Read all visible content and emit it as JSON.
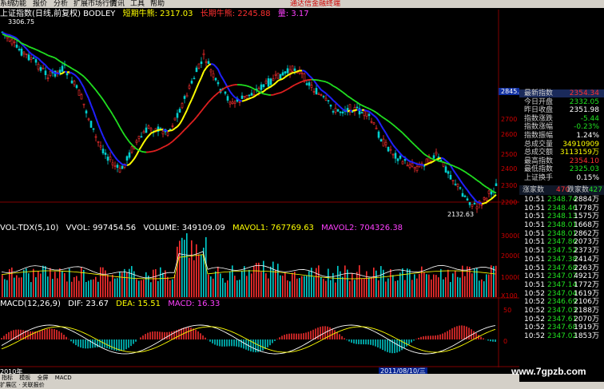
{
  "menu": [
    "系统",
    "功能",
    "报价",
    "分析",
    "扩展市场行情",
    "资讯",
    "工具",
    "帮助"
  ],
  "brand": "通达信金融终端",
  "main_legend": {
    "title": "上证指数(日线,前复权) BODLEY",
    "short_line": "短期牛熊: 2317.03",
    "long_line": "长期牛熊: 2245.88",
    "qty": "量: 3.17"
  },
  "price_axis": [
    "2845.5",
    "2700",
    "2600",
    "2500",
    "2400",
    "2300",
    "2200"
  ],
  "high_marker": "3306.75",
  "low_marker": "2132.63",
  "vol_legend": {
    "name": "VOL-TDX(5,10)",
    "vvol": "VVOL: 997454.56",
    "volume": "VOLUME: 349109.09",
    "mavol1": "MAVOL1: 767769.63",
    "mavol2": "MAVOL2: 704326.38"
  },
  "vol_axis": [
    "30000",
    "20000",
    "10000",
    "X100"
  ],
  "macd_legend": {
    "name": "MACD(12,26,9)",
    "dif": "DIF: 23.67",
    "dea": "DEA: 15.51",
    "macd": "MACD: 16.33"
  },
  "macd_axis": [
    "50",
    "0"
  ],
  "quote_panel": [
    {
      "k": "最新指数",
      "v": "2354.34",
      "c": "red"
    },
    {
      "k": "今日开盘",
      "v": "2332.05",
      "c": "green"
    },
    {
      "k": "昨日收盘",
      "v": "2351.98",
      "c": "white"
    },
    {
      "k": "指数涨跌",
      "v": "-5.44",
      "c": "green"
    },
    {
      "k": "指数涨幅",
      "v": "-0.23%",
      "c": "green"
    },
    {
      "k": "指数振幅",
      "v": "1.24%",
      "c": "white"
    },
    {
      "k": "总成交量",
      "v": "34910909",
      "c": "yellow"
    },
    {
      "k": "总成交额",
      "v": "3113159万",
      "c": "yellow"
    },
    {
      "k": "最高指数",
      "v": "2354.10",
      "c": "red"
    },
    {
      "k": "最低指数",
      "v": "2325.03",
      "c": "green"
    },
    {
      "k": "上证换手",
      "v": "0.15%",
      "c": "white"
    }
  ],
  "updown": {
    "up_label": "涨家数",
    "up": "470",
    "down_label": "跌家数",
    "down": "427"
  },
  "ticks": [
    [
      "10:51",
      "2348.74",
      "2884万"
    ],
    [
      "10:51",
      "2348.46",
      "1778万"
    ],
    [
      "10:51",
      "2348.13",
      "1575万"
    ],
    [
      "10:51",
      "2348.01",
      "1668万"
    ],
    [
      "10:51",
      "2348.01",
      "2862万"
    ],
    [
      "10:51",
      "2347.86",
      "2073万"
    ],
    [
      "10:51",
      "2347.52",
      "2373万"
    ],
    [
      "10:51",
      "2347.38",
      "2414万"
    ],
    [
      "10:51",
      "2347.68",
      "2263万"
    ],
    [
      "10:51",
      "2347.07",
      "4921万"
    ],
    [
      "10:51",
      "2347.14",
      "1772万"
    ],
    [
      "10:52",
      "2347.04",
      "1619万"
    ],
    [
      "10:52",
      "2346.69",
      "2106万"
    ],
    [
      "10:52",
      "2347.03",
      "2188万"
    ],
    [
      "10:52",
      "2347.61",
      "2070万"
    ],
    [
      "10:52",
      "2347.68",
      "1919万"
    ],
    [
      "10:52",
      "2347.02",
      "1853万"
    ]
  ],
  "bottom": {
    "date_label": "2011/08/10/三",
    "year_label": "2010年",
    "tabs": [
      "指标",
      "模板",
      "全屏",
      "MACD"
    ],
    "status": "扩展区 · 关联报价"
  },
  "watermark": "www.7gpzb.com",
  "colors": {
    "up": "#ff3030",
    "down": "#00d0d0",
    "blue_line": "#2020ff",
    "yellow_line": "#ffff00",
    "green_line": "#20e020",
    "red_line": "#e02020"
  }
}
